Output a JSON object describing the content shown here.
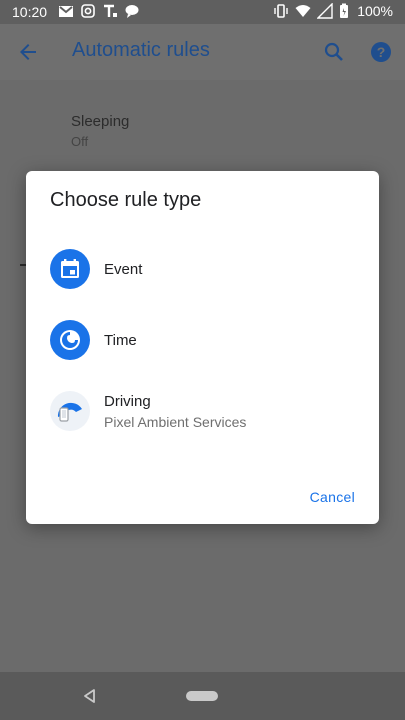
{
  "status_bar": {
    "time": "10:20",
    "battery": "100%",
    "icons_left": [
      "gmail-icon",
      "instagram-icon",
      "tmobile-icon",
      "chat-icon"
    ],
    "icons_right": [
      "vibrate-icon",
      "wifi-icon",
      "signal-icon",
      "battery-icon"
    ]
  },
  "app_bar": {
    "title": "Automatic rules",
    "title_color": "#1f4e8e"
  },
  "background_list": {
    "items": [
      {
        "title": "Sleeping",
        "subtitle": "Off"
      }
    ]
  },
  "dialog": {
    "title": "Choose rule type",
    "options": [
      {
        "label": "Event",
        "icon": "calendar-icon"
      },
      {
        "label": "Time",
        "icon": "clock-icon"
      },
      {
        "label": "Driving",
        "subtitle": "Pixel Ambient Services",
        "icon": "driving-icon"
      }
    ],
    "cancel_label": "Cancel",
    "accent_color": "#1a73e8"
  }
}
